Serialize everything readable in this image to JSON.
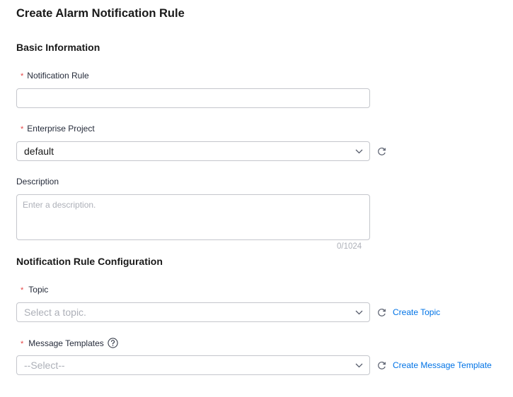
{
  "page": {
    "title": "Create Alarm Notification Rule"
  },
  "basic_info": {
    "section_title": "Basic Information",
    "notification_rule": {
      "label": "Notification Rule",
      "required_mark": "*",
      "value": ""
    },
    "enterprise_project": {
      "label": "Enterprise Project",
      "required_mark": "*",
      "selected_value": "default"
    },
    "description": {
      "label": "Description",
      "placeholder": "Enter a description.",
      "counter": "0/1024"
    }
  },
  "rule_config": {
    "section_title": "Notification Rule Configuration",
    "topic": {
      "label": "Topic",
      "required_mark": "*",
      "placeholder": "Select a topic.",
      "create_link": "Create Topic"
    },
    "message_templates": {
      "label": "Message Templates",
      "required_mark": "*",
      "placeholder": "--Select--",
      "create_link": "Create Message Template",
      "help_icon": "question-circle-icon"
    }
  },
  "colors": {
    "required": "#e54545",
    "link": "#0073e6",
    "border": "#c4c6cc",
    "placeholder": "#adb0b8"
  }
}
